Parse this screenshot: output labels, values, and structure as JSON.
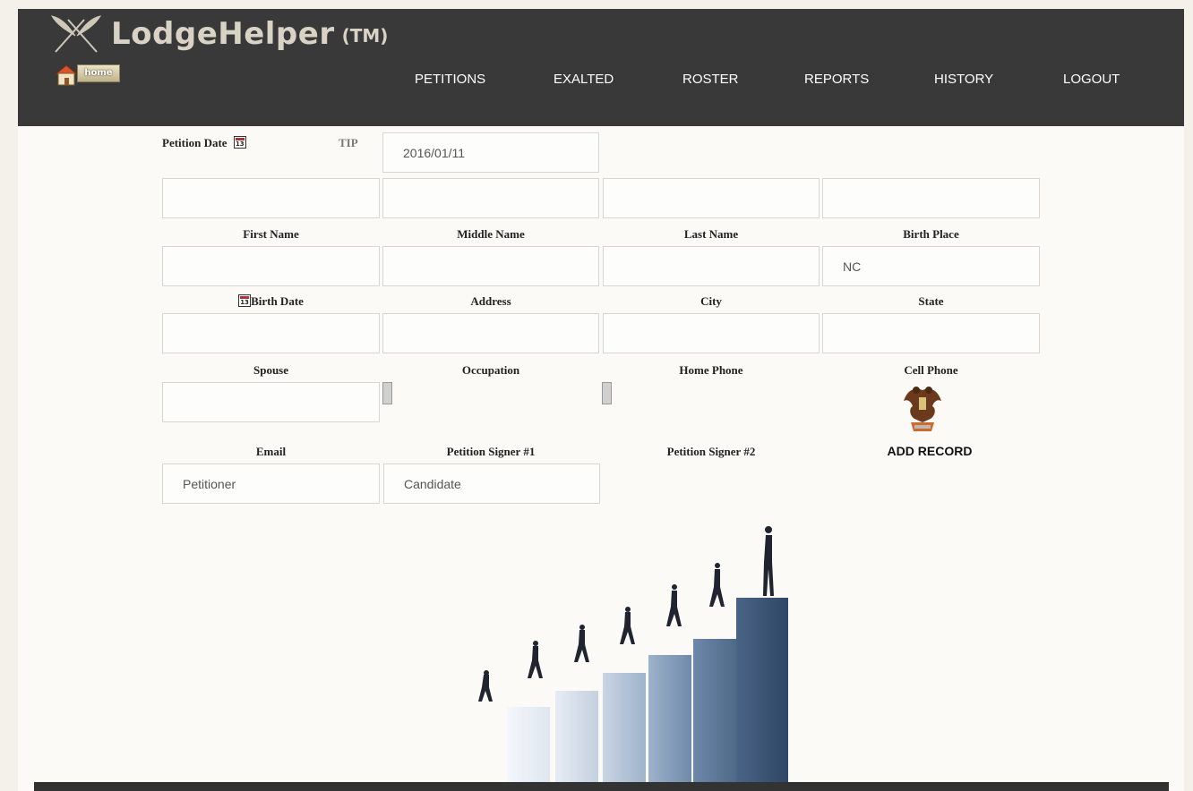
{
  "app": {
    "title": "LodgeHelper",
    "trademark": "(TM)",
    "home_label": "home"
  },
  "nav": {
    "items": [
      "PETITIONS",
      "EXALTED",
      "ROSTER",
      "REPORTS",
      "HISTORY",
      "LOGOUT"
    ]
  },
  "form": {
    "petition_date_label": "Petition Date",
    "tip_label": "TIP",
    "petition_date_value": "2016/01/11",
    "labels": {
      "first_name": "First Name",
      "middle_name": "Middle Name",
      "last_name": "Last Name",
      "birth_place": "Birth Place",
      "birth_date": "Birth Date",
      "address": "Address",
      "city": "City",
      "state": "State",
      "spouse": "Spouse",
      "occupation": "Occupation",
      "home_phone": "Home Phone",
      "cell_phone": "Cell Phone",
      "email": "Email",
      "signer1": "Petition Signer #1",
      "signer2": "Petition Signer #2"
    },
    "values": {
      "first_name": "",
      "middle_name": "",
      "last_name": "",
      "birth_place": "",
      "birth_date": "",
      "address": "",
      "city": "",
      "state": "NC",
      "spouse": "",
      "occupation": "",
      "home_phone": "",
      "cell_phone": "",
      "email": "",
      "signer1": "Petitioner",
      "signer2": "Candidate"
    },
    "add_record_label": "ADD RECORD"
  },
  "icons": {
    "logo": "crossed-quills-icon",
    "home": "house-icon",
    "calendar": "calendar-icon",
    "emblem": "double-headed-eagle-emblem"
  },
  "colors": {
    "header_bg": "#393939",
    "page_bg": "#fbfaf6",
    "nav_text": "#ffffff"
  }
}
